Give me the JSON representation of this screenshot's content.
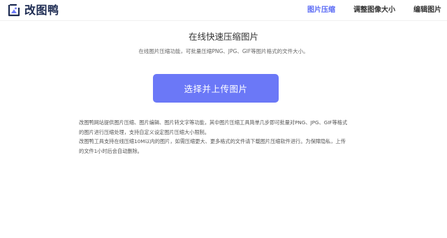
{
  "header": {
    "logo_text": "改图鸭",
    "logo_icon": "image-frame-icon",
    "nav": [
      {
        "label": "图片压缩",
        "active": true
      },
      {
        "label": "调整图像大小",
        "active": false
      },
      {
        "label": "编辑图片",
        "active": false
      }
    ]
  },
  "main": {
    "title": "在线快速压缩图片",
    "subtitle": "在线图片压缩功能，可批量压缩PNG、JPG、GIF等图片格式的文件大小。",
    "upload_button": "选择并上传图片",
    "description_lines": [
      "改图鸭网站提供图片压缩、图片编辑、图片转文字等功能，其中图片压缩工具简单几步即可批量对PNG、JPG、GIF等格式",
      "的图片进行压缩处理，支持自定义设定图片压缩大小限制。",
      "改图鸭工具支持在线压缩10M以内的图片，如需压缩更大、更多格式的文件请下载图片压缩软件进行。为保障隐私，上传",
      "的文件1小时后会自动删除。"
    ]
  },
  "colors": {
    "accent": "#5b6bf5",
    "button": "#6b78f7",
    "logo_text": "#1d2b52"
  }
}
